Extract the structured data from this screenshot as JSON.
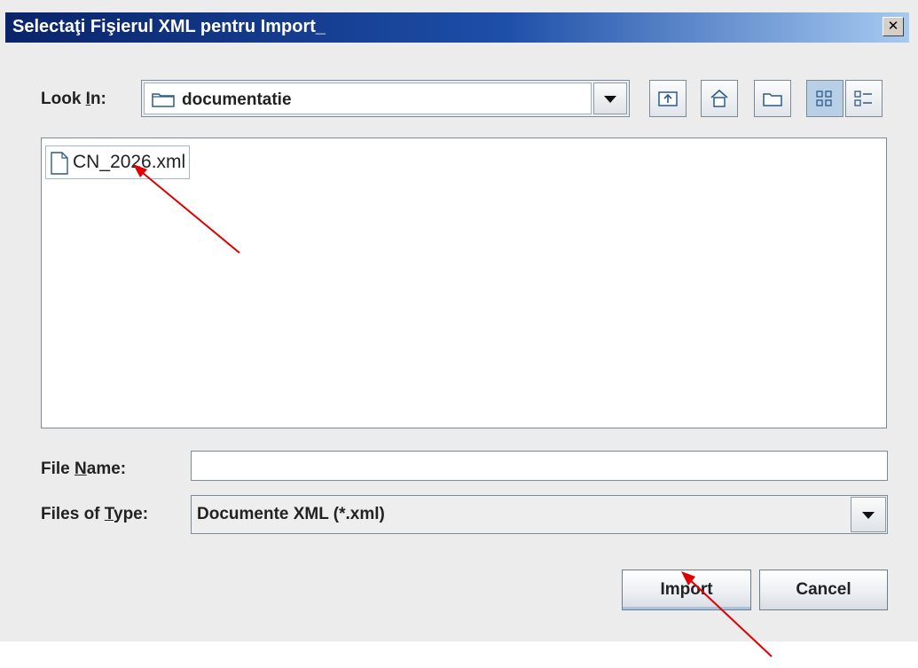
{
  "window": {
    "title": "Selectaţi Fişierul XML pentru Import_",
    "close_glyph": "✕"
  },
  "look_in": {
    "label": "Look In:",
    "mnemonic": "I",
    "value": "documentatie",
    "folder_icon": "folder-icon"
  },
  "toolbar": {
    "buttons": [
      {
        "name": "up-one-level-icon"
      },
      {
        "name": "home-icon"
      },
      {
        "name": "new-folder-icon"
      },
      {
        "name": "list-view-icon",
        "selected": true
      },
      {
        "name": "details-view-icon"
      }
    ]
  },
  "files": [
    {
      "name": "CN_2026.xml",
      "icon": "file-icon"
    }
  ],
  "file_name": {
    "label": "File Name:",
    "mnemonic": "N",
    "value": ""
  },
  "file_type": {
    "label": "Files of Type:",
    "mnemonic": "T",
    "value": "Documente XML (*.xml)"
  },
  "buttons": {
    "import_label": "Import",
    "cancel_label": "Cancel"
  },
  "colors": {
    "title_start": "#0a246a",
    "title_end": "#a6caf0",
    "annotation_arrow": "#e00000",
    "dialog_bg": "#ececec"
  }
}
